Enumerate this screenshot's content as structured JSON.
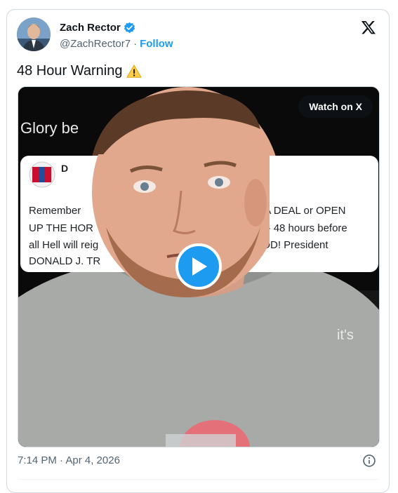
{
  "author": {
    "name": "Zach Rector",
    "handle": "@ZachRector7",
    "separator": "·",
    "follow_label": "Follow"
  },
  "tweet": {
    "text": "48 Hour Warning",
    "emoji_icon": "warning-icon",
    "timestamp": "7:14 PM · Apr 4, 2026"
  },
  "media": {
    "watch_label": "Watch on X",
    "background_texts": {
      "glory": "Glory be",
      "its": "it's",
      "quote_initial": "D"
    },
    "quoted_post_lines": {
      "line1_left": "Remember",
      "line1_right": "AKE A DEAL or OPEN",
      "line2_left": "UP THE HOR",
      "line2_right": "g out - 48 hours before",
      "line3_left": "all Hell will reig",
      "line3_right": "to GOD! President",
      "line4_left": "DONALD J. TR"
    }
  },
  "colors": {
    "accent": "#1d9bf0",
    "text": "#0f1419",
    "muted": "#536471",
    "border": "#cfd9de"
  }
}
